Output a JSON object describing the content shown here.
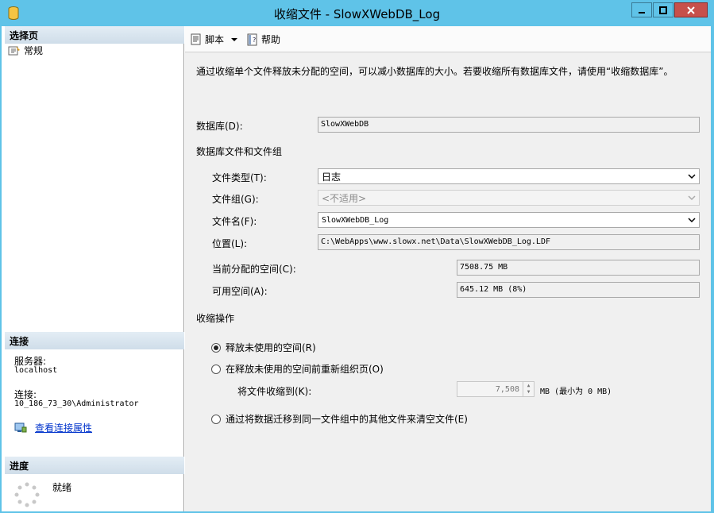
{
  "window": {
    "title": "收缩文件 - SlowXWebDB_Log"
  },
  "left": {
    "select_page_header": "选择页",
    "pages": [
      {
        "label": "常规",
        "icon": "general-page-icon"
      }
    ],
    "connection_header": "连接",
    "server_label": "服务器:",
    "server_value": "localhost",
    "connection_label": "连接:",
    "connection_value": "10_186_73_30\\Administrator",
    "view_props_link": "查看连接属性",
    "progress_header": "进度",
    "progress_status": "就绪"
  },
  "toolbar": {
    "script_label": "脚本",
    "help_label": "帮助"
  },
  "main": {
    "description": "通过收缩单个文件释放未分配的空间，可以减小数据库的大小。若要收缩所有数据库文件，请使用“收缩数据库”。",
    "database_label": "数据库(D):",
    "database_value": "SlowXWebDB",
    "files_group_header": "数据库文件和文件组",
    "file_type_label": "文件类型(T):",
    "file_type_value": "日志",
    "filegroup_label": "文件组(G):",
    "filegroup_value": "<不适用>",
    "file_name_label": "文件名(F):",
    "file_name_value": "SlowXWebDB_Log",
    "location_label": "位置(L):",
    "location_value": "C:\\WebApps\\www.slowx.net\\Data\\SlowXWebDB_Log.LDF",
    "allocated_label": "当前分配的空间(C):",
    "allocated_value": "7508.75 MB",
    "available_label": "可用空间(A):",
    "available_value": "645.12 MB (8%)",
    "shrink_header": "收缩操作",
    "option_release": "释放未使用的空间(R)",
    "option_reorganize": "在释放未使用的空间前重新组织页(O)",
    "shrink_to_label": "将文件收缩到(K):",
    "shrink_to_value": "7,508",
    "shrink_to_unit": "MB (最小为 0 MB)",
    "option_empty": "通过将数据迁移到同一文件组中的其他文件来清空文件(E)"
  }
}
